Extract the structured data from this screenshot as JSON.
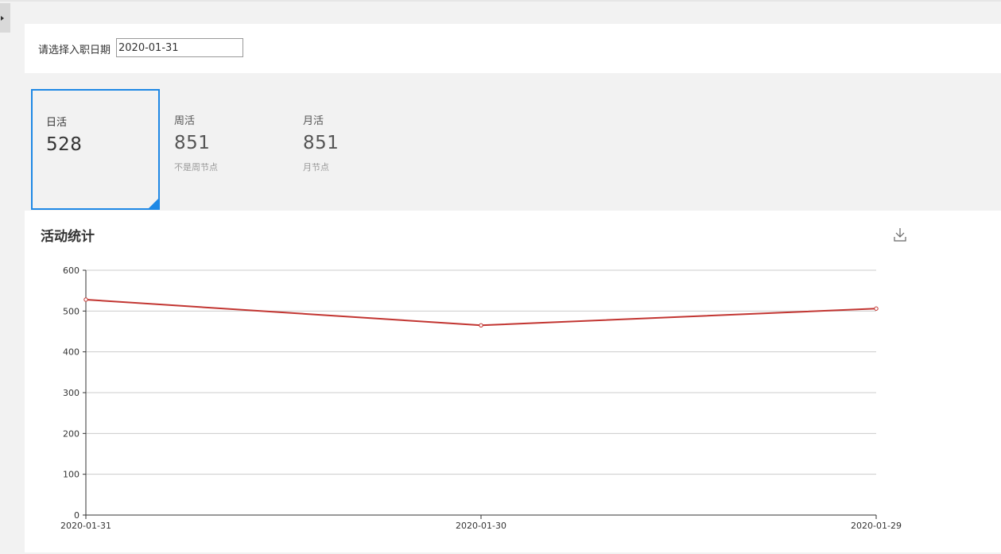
{
  "filter": {
    "label": "请选择入职日期",
    "date_value": "2020-01-31"
  },
  "stats": [
    {
      "title": "日活",
      "value": "528",
      "sub": "",
      "active": true
    },
    {
      "title": "周活",
      "value": "851",
      "sub": "不是周节点",
      "active": false
    },
    {
      "title": "月活",
      "value": "851",
      "sub": "月节点",
      "active": false
    }
  ],
  "chart": {
    "title": "活动统计",
    "download_icon": "download-icon"
  },
  "colors": {
    "accent": "#1e88e5",
    "line": "#c23531"
  },
  "chart_data": {
    "type": "line",
    "categories": [
      "2020-01-31",
      "2020-01-30",
      "2020-01-29"
    ],
    "series": [
      {
        "values": [
          528,
          465,
          506
        ]
      }
    ],
    "ylim": [
      0,
      600
    ],
    "yticks": [
      0,
      100,
      200,
      300,
      400,
      500,
      600
    ],
    "grid": true,
    "legend": "none"
  }
}
